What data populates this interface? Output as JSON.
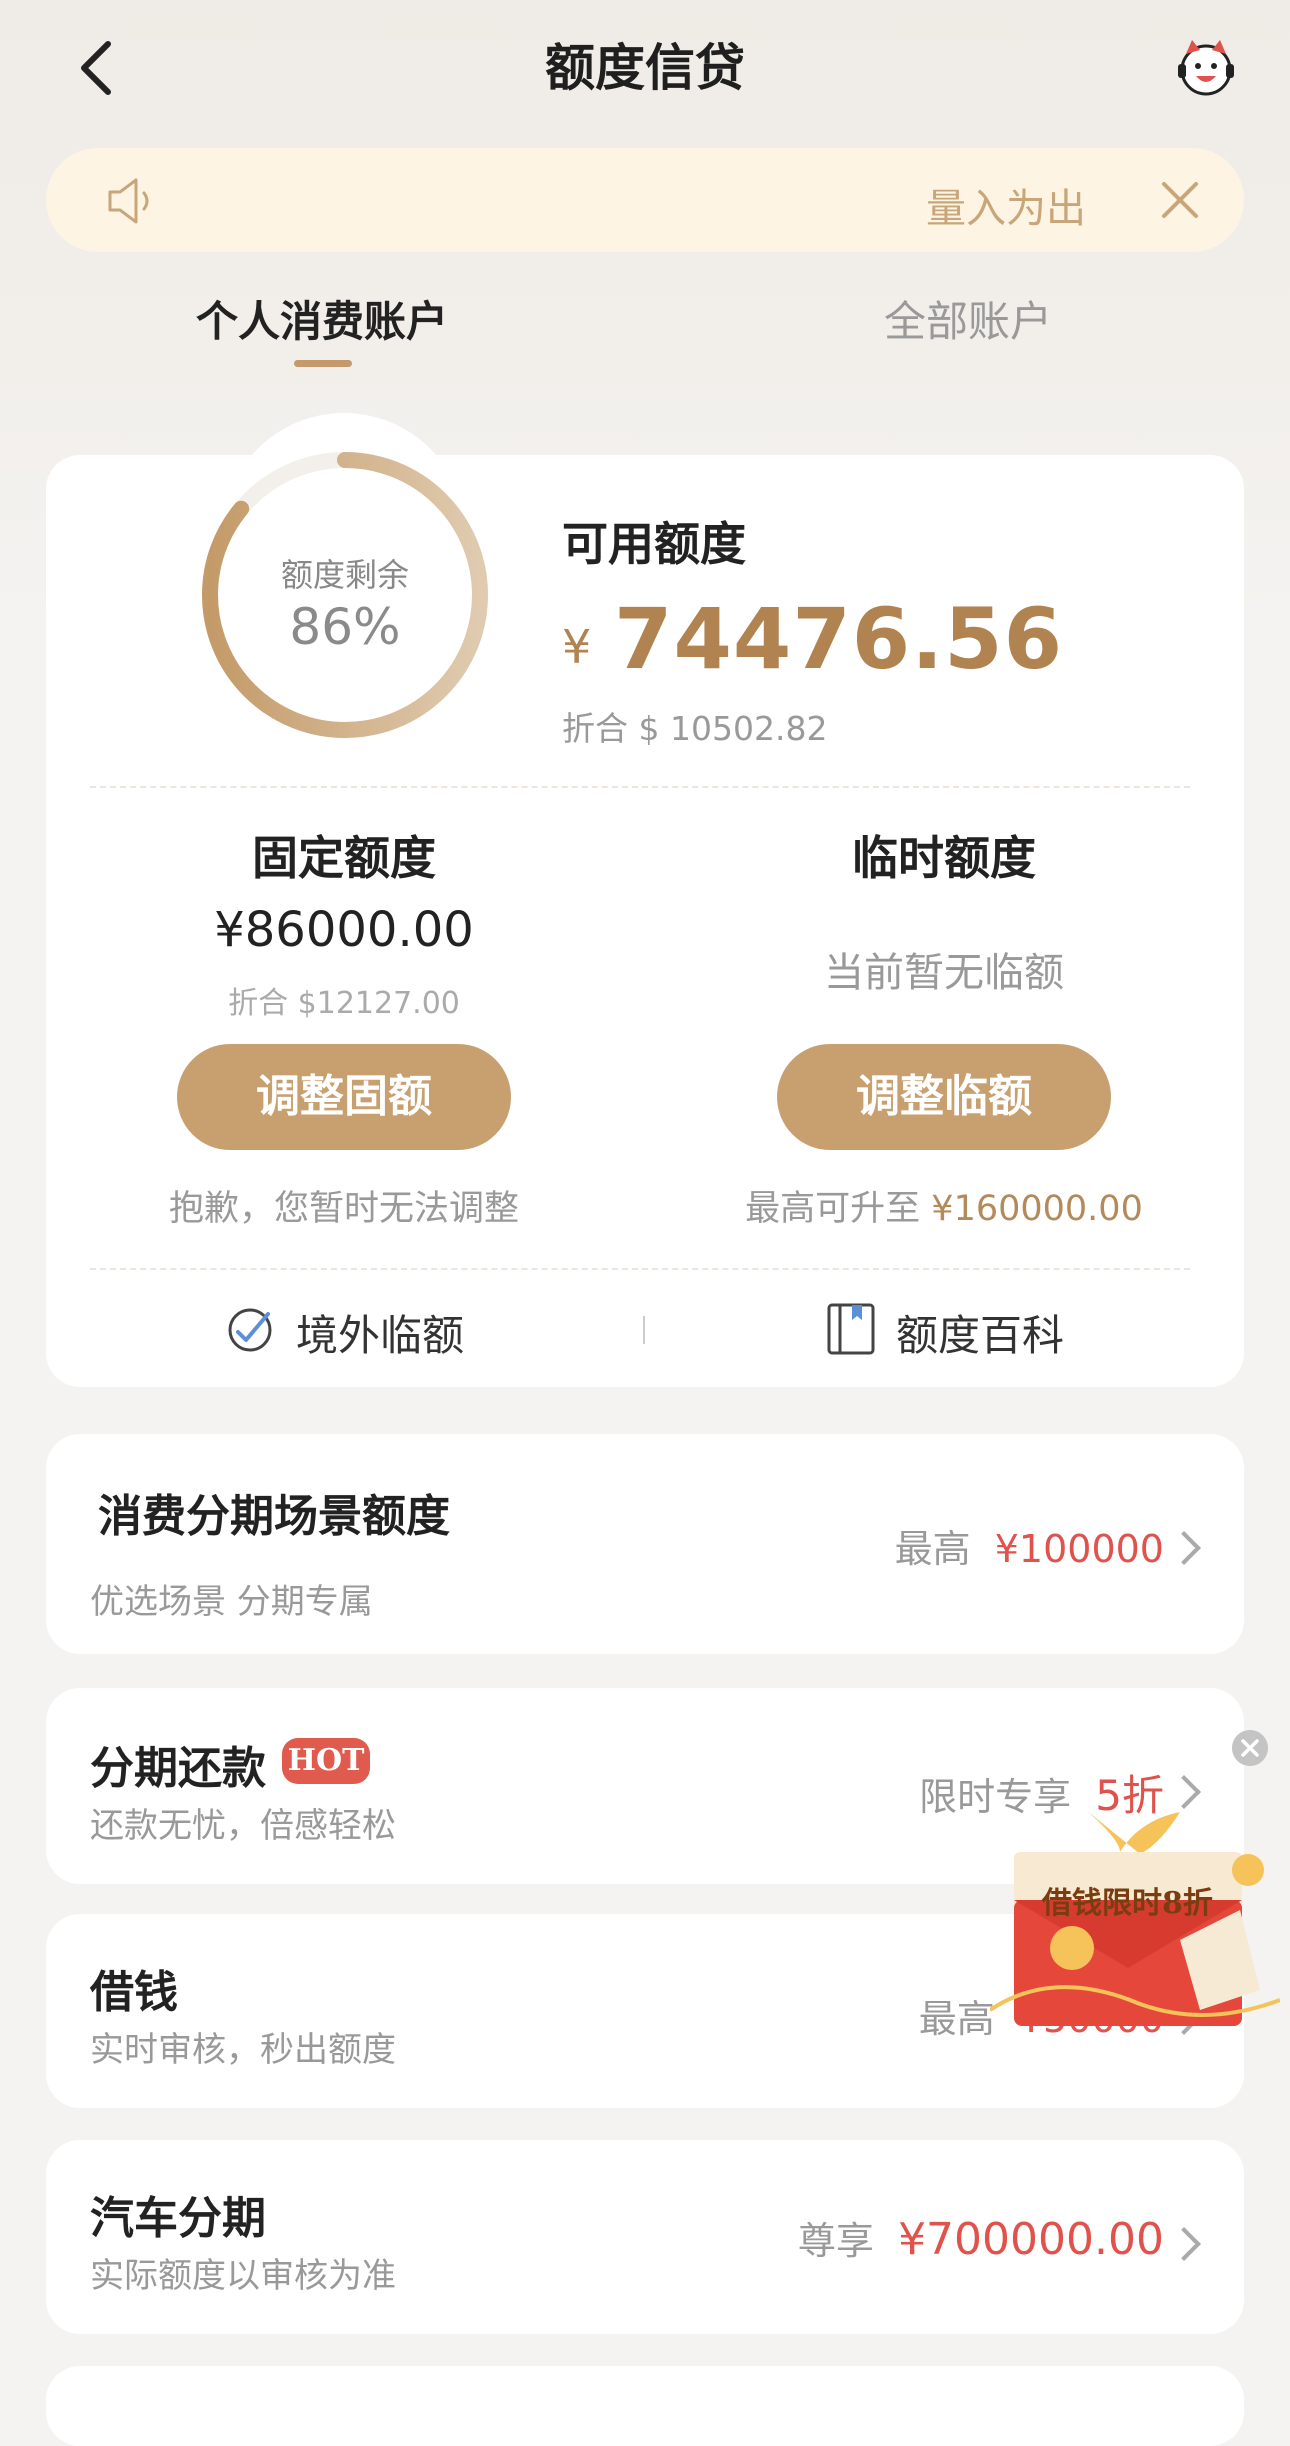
{
  "header": {
    "title": "额度信贷"
  },
  "notice": {
    "text": "量入为出"
  },
  "tabs": [
    {
      "label": "个人消费账户"
    },
    {
      "label": "全部账户"
    }
  ],
  "summary": {
    "ring_label": "额度剩余",
    "ring_percent": "86%",
    "ring_fraction": 0.86,
    "available_label": "可用额度",
    "currency_symbol": "¥",
    "available_amount": "74476.56",
    "available_usd": "折合 $ 10502.82"
  },
  "fixed": {
    "title": "固定额度",
    "amount": "¥86000.00",
    "usd": "折合 $12127.00",
    "button": "调整固额",
    "note": "抱歉，您暂时无法调整"
  },
  "temporary": {
    "title": "临时额度",
    "status": "当前暂无临额",
    "button": "调整临额",
    "note_prefix": "最高可升至",
    "note_amount": "¥160000.00"
  },
  "links": {
    "overseas": "境外临额",
    "wiki": "额度百科"
  },
  "list": {
    "consumer": {
      "title": "消费分期场景额度",
      "subtitle": "优选场景 分期专属",
      "right_prefix": "最高",
      "right_value": "¥100000"
    },
    "installment": {
      "title": "分期还款",
      "badge": "HOT",
      "subtitle": "还款无忧，倍感轻松",
      "right_prefix": "限时专享",
      "right_value": "5折"
    },
    "borrow": {
      "title": "借钱",
      "subtitle": "实时审核，秒出额度",
      "right_prefix": "最高",
      "right_value": "¥50000"
    },
    "car": {
      "title": "汽车分期",
      "subtitle": "实际额度以审核为准",
      "right_prefix": "尊享",
      "right_value": "¥700000.00"
    }
  },
  "promo": {
    "text": "借钱限时8折"
  },
  "colors": {
    "accent": "#c89f6f",
    "gold_text": "#b08350",
    "red": "#e0524c"
  }
}
